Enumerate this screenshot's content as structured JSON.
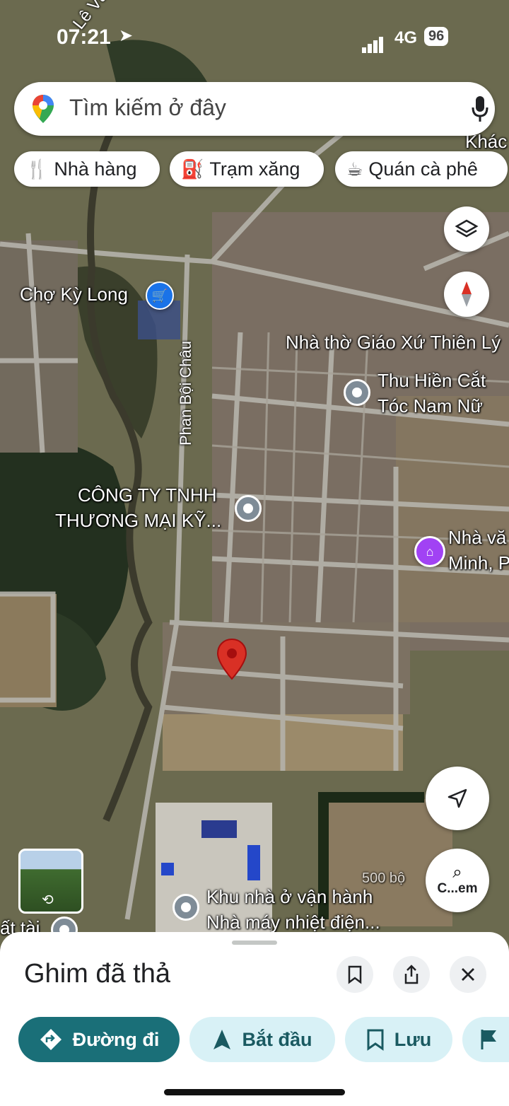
{
  "status_bar": {
    "time": "07:21",
    "network": "4G",
    "battery": "96"
  },
  "search": {
    "placeholder": "Tìm kiếm ở đây"
  },
  "chips": [
    {
      "icon": "restaurant-icon",
      "label": "Nhà hàng"
    },
    {
      "icon": "gas-station-icon",
      "label": "Trạm xăng"
    },
    {
      "icon": "coffee-icon",
      "label": "Quán cà phê"
    }
  ],
  "map": {
    "labels": {
      "market": "Chợ Kỳ Long",
      "church": "Nhà thờ Giáo Xứ Thiên Lý",
      "barber_1": "Thu Hiền Cắt",
      "barber_2": "Tóc Nam Nữ",
      "company_1": "CÔNG TY TNHH",
      "company_2": "THƯƠNG MẠI KỸ...",
      "culture_1": "Nhà vă",
      "culture_2": "Minh, P",
      "housing_1": "Khu nhà ở vận hành",
      "housing_2": "Nhà máy nhiệt điện...",
      "other_top": "Khác",
      "bottom_left": "ất tài",
      "scale": "500 bộ"
    },
    "streets": {
      "top": "Lê Văn Thiện",
      "main": "Phan Bội Châu"
    }
  },
  "controls": {
    "camera_label": "C...em"
  },
  "sheet": {
    "title": "Ghim đã thả",
    "buttons": {
      "directions": "Đường đi",
      "start": "Bắt đầu",
      "save": "Lưu"
    }
  },
  "colors": {
    "primary": "#1a6f78",
    "pill_light": "#d8f1f6",
    "pin": "#d93025"
  }
}
